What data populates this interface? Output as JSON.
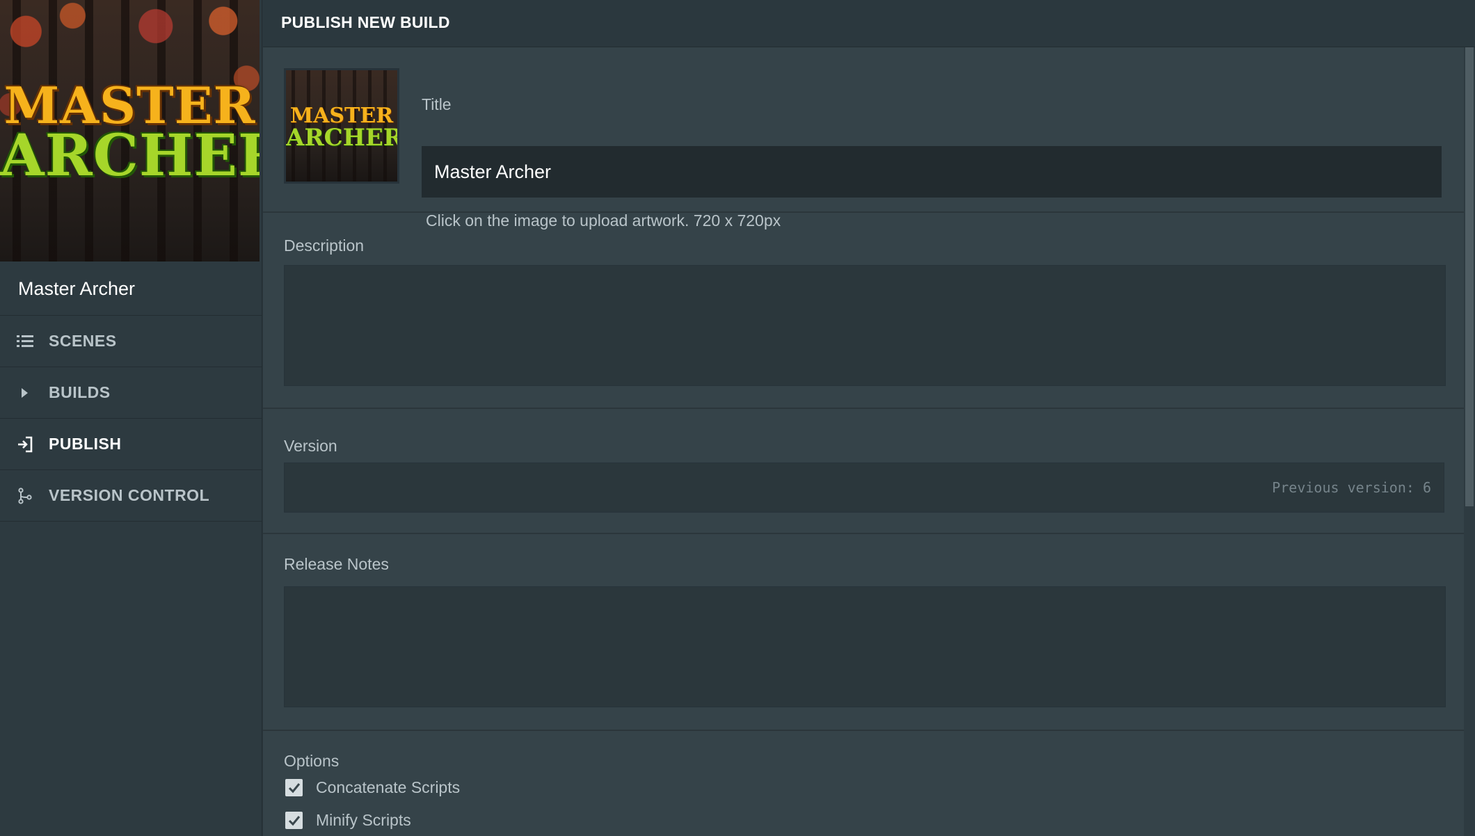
{
  "sidebar": {
    "cover_logo": {
      "line1": "MASTER",
      "line2": "ARCHER"
    },
    "project_name": "Master Archer",
    "items": [
      {
        "label": "SCENES",
        "icon": "list-icon",
        "active": false
      },
      {
        "label": "BUILDS",
        "icon": "play-icon",
        "active": false
      },
      {
        "label": "PUBLISH",
        "icon": "publish-icon",
        "active": true
      },
      {
        "label": "VERSION CONTROL",
        "icon": "branch-icon",
        "active": false
      }
    ]
  },
  "header": {
    "title": "PUBLISH NEW BUILD"
  },
  "form": {
    "title_label": "Title",
    "title_value": "Master Archer",
    "artwork_hint": "Click on the image to upload artwork. 720 x 720px",
    "description_label": "Description",
    "description_value": "",
    "version_label": "Version",
    "version_placeholder": "Previous version: 6",
    "release_notes_label": "Release Notes",
    "release_notes_value": "",
    "options_label": "Options",
    "options": [
      {
        "label": "Concatenate Scripts",
        "checked": true
      },
      {
        "label": "Minify Scripts",
        "checked": true
      }
    ]
  },
  "colors": {
    "sidebar_bg": "#2d3a40",
    "main_bg": "#354349",
    "field_bg": "#2b373c",
    "title_field_bg": "#222b2f",
    "text_muted": "#b9c4c9",
    "logo_orange": "#f6b21c",
    "logo_green": "#a6d62a"
  }
}
